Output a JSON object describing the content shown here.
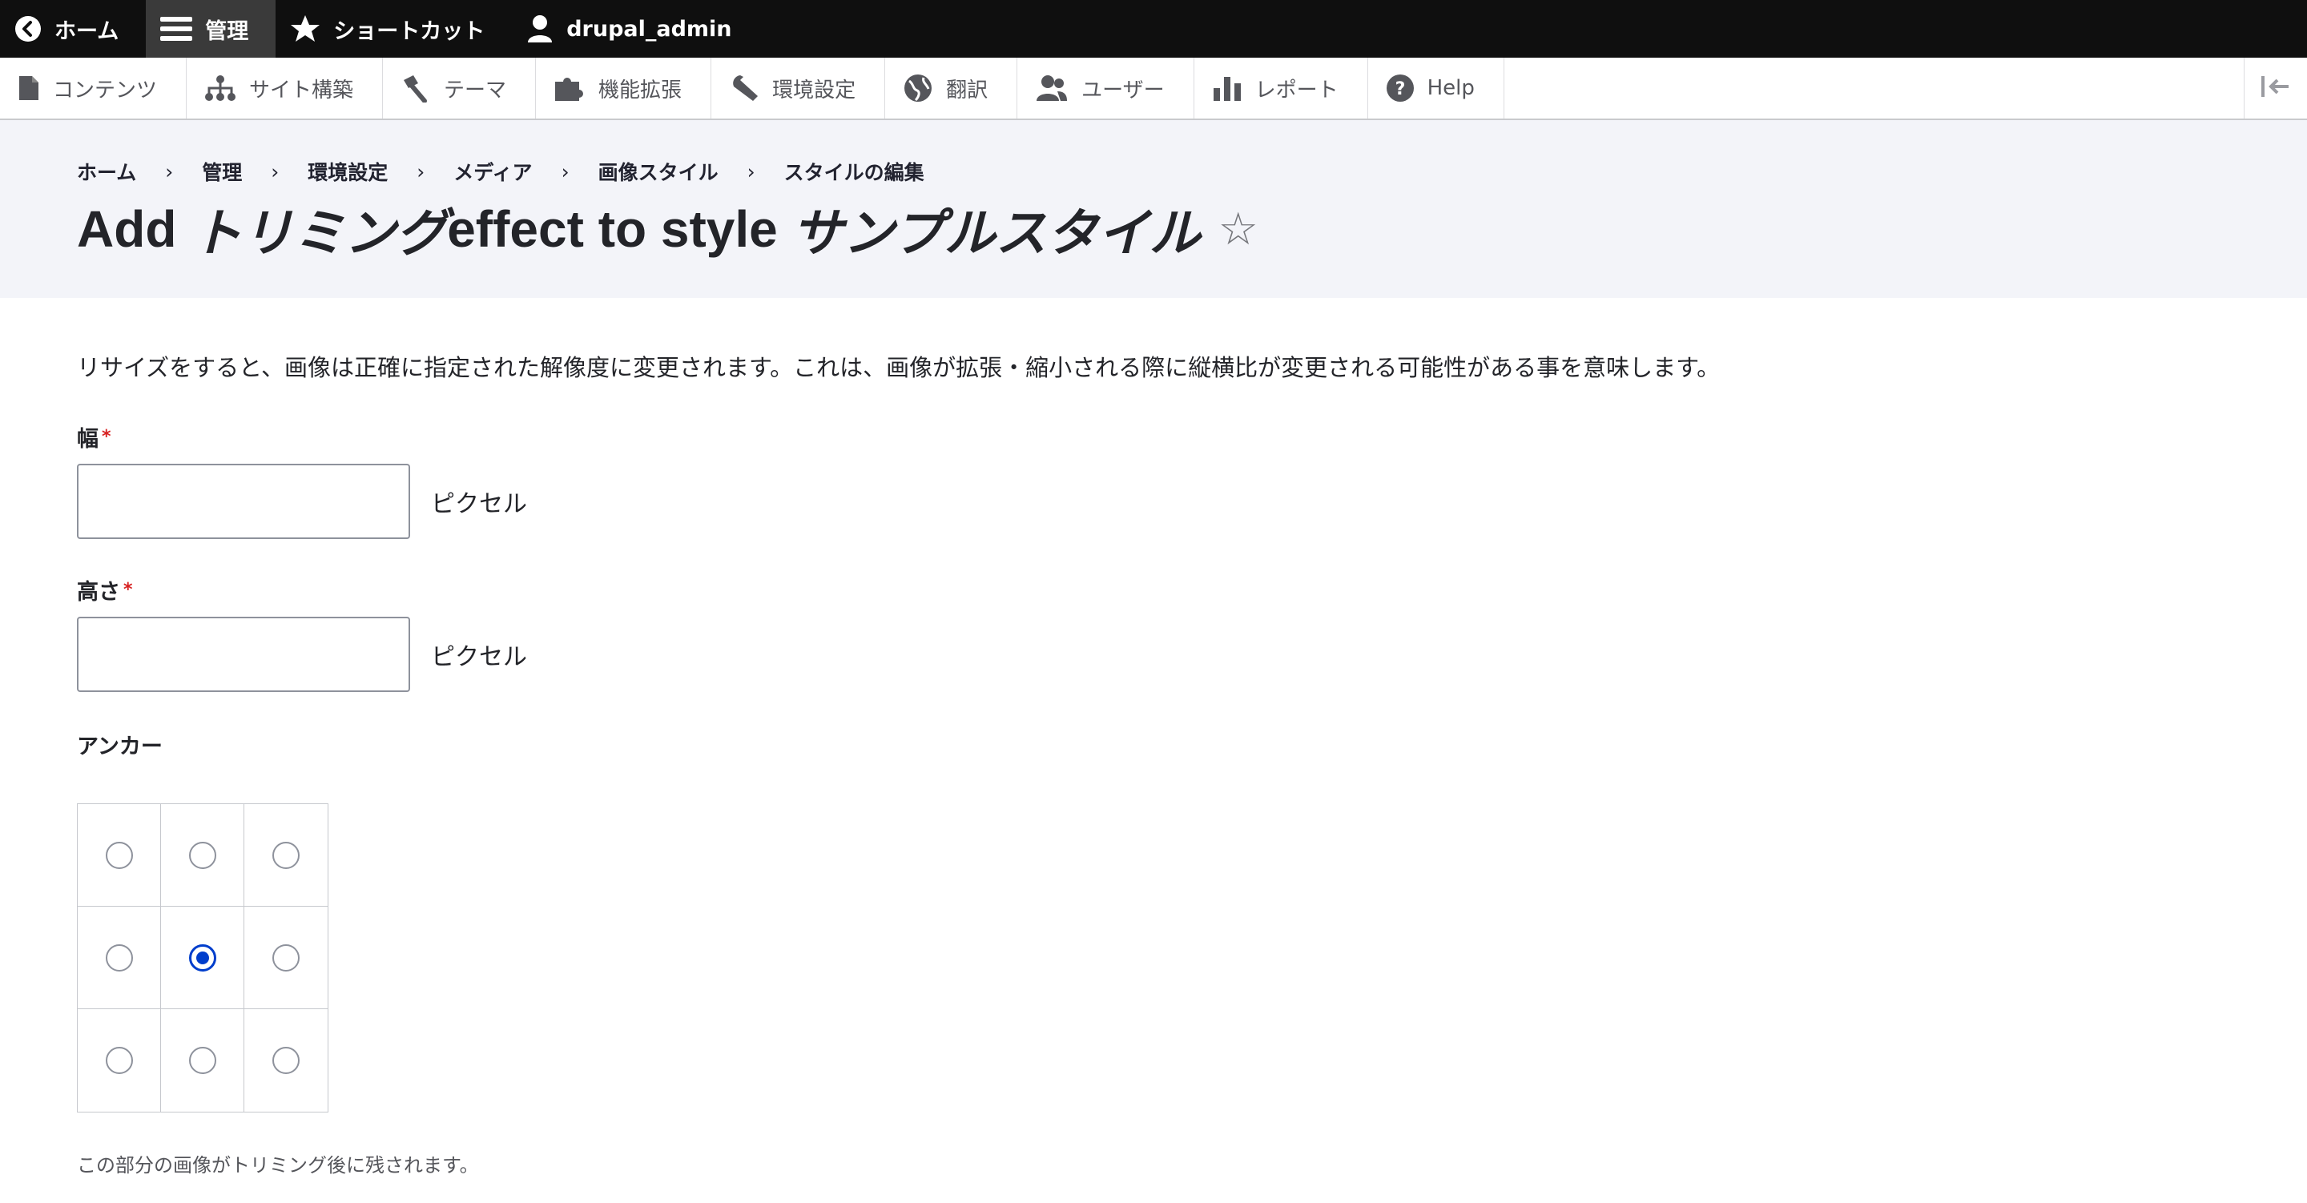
{
  "toolbar": {
    "home": "ホーム",
    "manage": "管理",
    "shortcuts": "ショートカット",
    "user": "drupal_admin"
  },
  "tray": {
    "items": [
      {
        "label": "コンテンツ",
        "icon": "file-icon"
      },
      {
        "label": "サイト構築",
        "icon": "sitemap-icon"
      },
      {
        "label": "テーマ",
        "icon": "paintbrush-icon"
      },
      {
        "label": "機能拡張",
        "icon": "puzzle-icon"
      },
      {
        "label": "環境設定",
        "icon": "wrench-icon"
      },
      {
        "label": "翻訳",
        "icon": "globe-icon"
      },
      {
        "label": "ユーザー",
        "icon": "people-icon"
      },
      {
        "label": "レポート",
        "icon": "bar-chart-icon"
      },
      {
        "label": "Help",
        "icon": "help-icon"
      }
    ]
  },
  "breadcrumb": {
    "items": [
      "ホーム",
      "管理",
      "環境設定",
      "メディア",
      "画像スタイル",
      "スタイルの編集"
    ],
    "separator": "›"
  },
  "title": {
    "prefix": "Add ",
    "effect": "トリミング",
    "middle": "effect to style ",
    "style": "サンプルスタイル",
    "star": "☆"
  },
  "form": {
    "description": "リサイズをすると、画像は正確に指定された解像度に変更されます。これは、画像が拡張・縮小される際に縦横比が変更される可能性がある事を意味します。",
    "width": {
      "label": "幅",
      "required_mark": "*",
      "value": "",
      "suffix": "ピクセル"
    },
    "height": {
      "label": "高さ",
      "required_mark": "*",
      "value": "",
      "suffix": "ピクセル"
    },
    "anchor": {
      "label": "アンカー",
      "selected": "center-center",
      "help": "この部分の画像がトリミング後に残されます。"
    }
  },
  "colors": {
    "toolbar_bg": "#0f0f0f",
    "header_bg": "#f3f4f9",
    "accent": "#003ecc",
    "required": "#d72222"
  }
}
